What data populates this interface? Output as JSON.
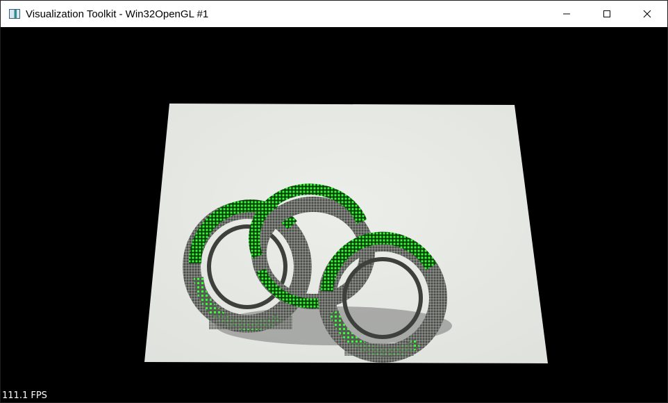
{
  "window": {
    "title": "Visualization Toolkit - Win32OpenGL #1",
    "icon": "vtk-app-icon",
    "controls": {
      "minimize_icon": "minimize-icon",
      "maximize_icon": "maximize-icon",
      "close_icon": "close-icon"
    }
  },
  "viewport": {
    "fps_label": "111.1 FPS",
    "background_color": "#000000",
    "paper_color": "#e9eae7",
    "highlight_color": "#33ff33",
    "ring_color": "#5c5f5a"
  }
}
